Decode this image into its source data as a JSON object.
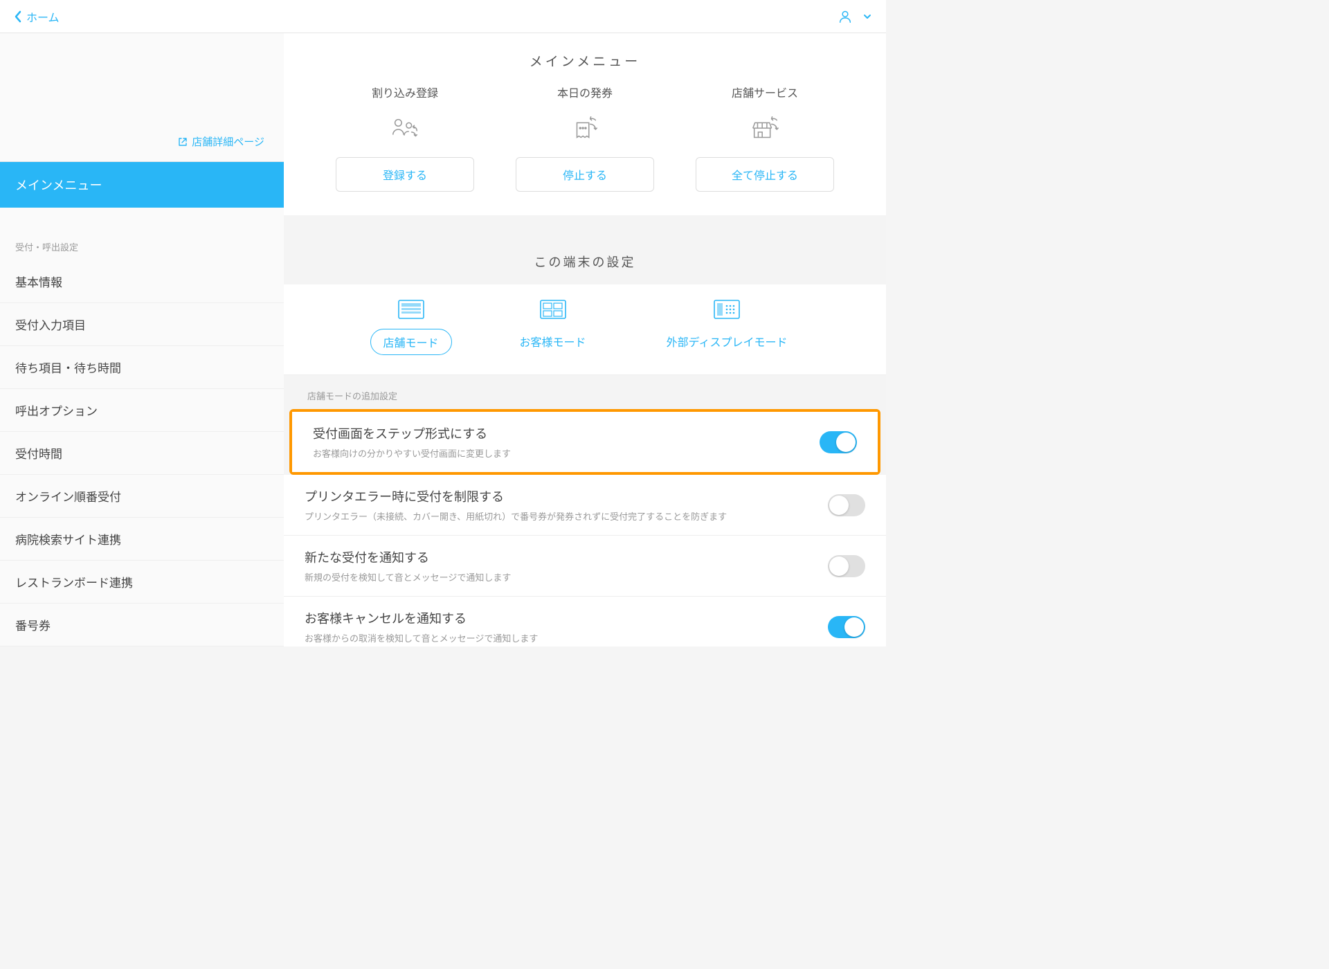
{
  "header": {
    "back_label": "ホーム"
  },
  "sidebar": {
    "store_detail_link": "店舗詳細ページ",
    "active_item": "メインメニュー",
    "section_label": "受付・呼出設定",
    "items": [
      "基本情報",
      "受付入力項目",
      "待ち項目・待ち時間",
      "呼出オプション",
      "受付時間",
      "オンライン順番受付",
      "病院検索サイト連携",
      "レストランボード連携",
      "番号券"
    ]
  },
  "main": {
    "main_menu_title": "メインメニュー",
    "cards": [
      {
        "label": "割り込み登録",
        "button": "登録する"
      },
      {
        "label": "本日の発券",
        "button": "停止する"
      },
      {
        "label": "店舗サービス",
        "button": "全て停止する"
      }
    ],
    "terminal_title": "この端末の設定",
    "modes": [
      {
        "label": "店舗モード",
        "active": true
      },
      {
        "label": "お客様モード",
        "active": false
      },
      {
        "label": "外部ディスプレイモード",
        "active": false
      }
    ],
    "settings_section_label": "店舗モードの追加設定",
    "settings": [
      {
        "title": "受付画面をステップ形式にする",
        "desc": "お客様向けの分かりやすい受付画面に変更します",
        "on": true,
        "highlight": true
      },
      {
        "title": "プリンタエラー時に受付を制限する",
        "desc": "プリンタエラー（未接続、カバー開き、用紙切れ）で番号券が発券されずに受付完了することを防ぎます",
        "on": false
      },
      {
        "title": "新たな受付を通知する",
        "desc": "新規の受付を検知して音とメッセージで通知します",
        "on": false
      },
      {
        "title": "お客様キャンセルを通知する",
        "desc": "お客様からの取消を検知して音とメッセージで通知します",
        "on": true
      }
    ]
  }
}
